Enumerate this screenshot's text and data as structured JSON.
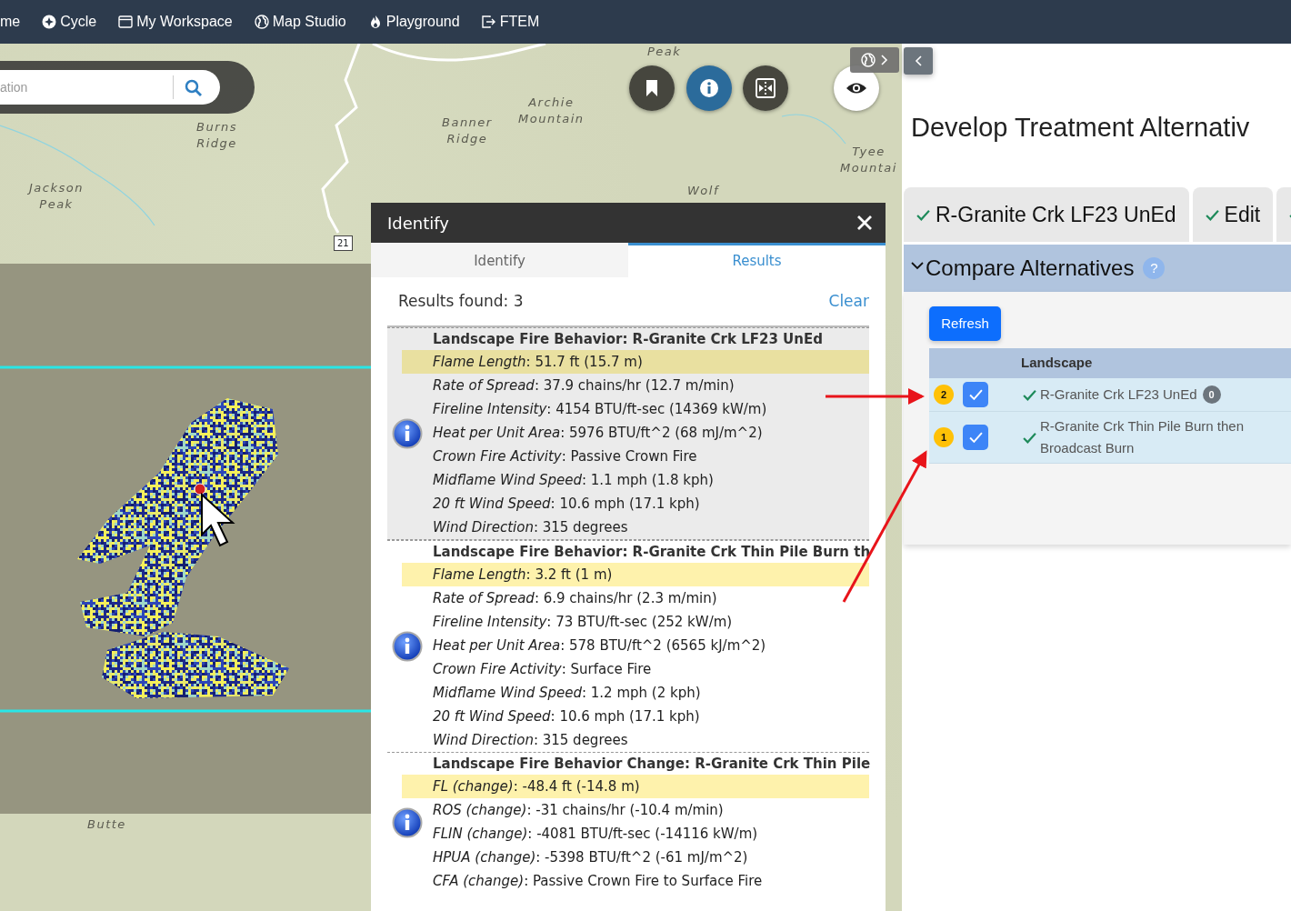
{
  "nav": {
    "items": [
      {
        "label": "me"
      },
      {
        "label": "Cycle"
      },
      {
        "label": "My Workspace"
      },
      {
        "label": "Map Studio"
      },
      {
        "label": "Playground"
      },
      {
        "label": "FTEM"
      }
    ]
  },
  "map": {
    "search": {
      "placeholder": "ation"
    },
    "labels": [
      {
        "text": "Peak"
      },
      {
        "text": "Burns Ridge"
      },
      {
        "text": "Banner Ridge"
      },
      {
        "text": "Archie Mountain"
      },
      {
        "text": "Tyee Mountai"
      },
      {
        "text": "Jackson Peak"
      },
      {
        "text": "Wolf"
      },
      {
        "text": "Butte"
      }
    ],
    "route_shield": "21",
    "tools": [
      {
        "kind": "bookmark",
        "selected": false
      },
      {
        "kind": "info",
        "selected": true
      },
      {
        "kind": "split",
        "selected": false
      }
    ]
  },
  "identify": {
    "title": "Identify",
    "tabs": [
      {
        "label": "Identify",
        "selected": false
      },
      {
        "label": "Results",
        "selected": true
      }
    ],
    "results_found": "Results found: 3",
    "clear": "Clear",
    "groups": [
      {
        "title": "Landscape Fire Behavior: R-Granite Crk LF23 UnEd",
        "selected": true,
        "fields": [
          {
            "text": "*Flame Length*: 51.7 ft (15.7 m)",
            "highlighted": true
          },
          {
            "text": "*Rate of Spread*: 37.9 chains/hr (12.7 m/min)",
            "highlighted": false
          },
          {
            "text": "*Fireline Intensity*: 4154 BTU/ft-sec (14369 kW/m)",
            "highlighted": false
          },
          {
            "text": "*Heat per Unit Area*: 5976 BTU/ft^2 (68 mJ/m^2)",
            "highlighted": false
          },
          {
            "text": "*Crown Fire Activity*: Passive Crown Fire",
            "highlighted": false
          },
          {
            "text": "*Midflame Wind Speed*: 1.1 mph (1.8 kph)",
            "highlighted": false
          },
          {
            "text": "*20 ft Wind Speed*: 10.6 mph (17.1 kph)",
            "highlighted": false
          },
          {
            "text": "*Wind Direction*: 315 degrees",
            "highlighted": false
          }
        ]
      },
      {
        "title": "Landscape Fire Behavior: R-Granite Crk Thin Pile Burn th",
        "selected": false,
        "fields": [
          {
            "text": "*Flame Length*: 3.2 ft (1 m)",
            "highlighted": true
          },
          {
            "text": "*Rate of Spread*: 6.9 chains/hr (2.3 m/min)",
            "highlighted": false
          },
          {
            "text": "*Fireline Intensity*: 73 BTU/ft-sec (252 kW/m)",
            "highlighted": false
          },
          {
            "text": "*Heat per Unit Area*: 578 BTU/ft^2 (6565 kJ/m^2)",
            "highlighted": false
          },
          {
            "text": "*Crown Fire Activity*: Surface Fire",
            "highlighted": false
          },
          {
            "text": "*Midflame Wind Speed*: 1.2 mph (2 kph)",
            "highlighted": false
          },
          {
            "text": "*20 ft Wind Speed*: 10.6 mph (17.1 kph)",
            "highlighted": false
          },
          {
            "text": "*Wind Direction*: 315 degrees",
            "highlighted": false
          }
        ]
      },
      {
        "title": "Landscape Fire Behavior Change: R-Granite Crk Thin Pile",
        "selected": false,
        "fields": [
          {
            "text": "*FL (change)*: -48.4 ft (-14.8 m)",
            "highlighted": true
          },
          {
            "text": "*ROS (change)*: -31 chains/hr (-10.4 m/min)",
            "highlighted": false
          },
          {
            "text": "*FLIN (change)*: -4081 BTU/ft-sec (-14116 kW/m)",
            "highlighted": false
          },
          {
            "text": "*HPUA (change)*: -5398 BTU/ft^2 (-61 mJ/m^2)",
            "highlighted": false
          },
          {
            "text": "*CFA (change)*: Passive Crown Fire to Surface Fire",
            "highlighted": false
          }
        ]
      }
    ]
  },
  "workflow": {
    "title": "Develop Treatment Alternativ",
    "tabs": [
      {
        "label": "R-Granite Crk LF23 UnEd",
        "done": true
      },
      {
        "label": "Edit",
        "done": true
      },
      {
        "done": true
      }
    ]
  },
  "compare": {
    "title": "Compare Alternatives",
    "help": "?",
    "expanded": true,
    "refresh": "Refresh",
    "columns": [
      "Landscape"
    ],
    "rows": [
      {
        "rank": "2",
        "checked": true,
        "done": true,
        "name": "R-Granite Crk LF23 UnEd",
        "count": "0"
      },
      {
        "rank": "1",
        "checked": true,
        "done": true,
        "name": "R-Granite Crk Thin Pile Burn then Broadcast Burn"
      }
    ]
  }
}
